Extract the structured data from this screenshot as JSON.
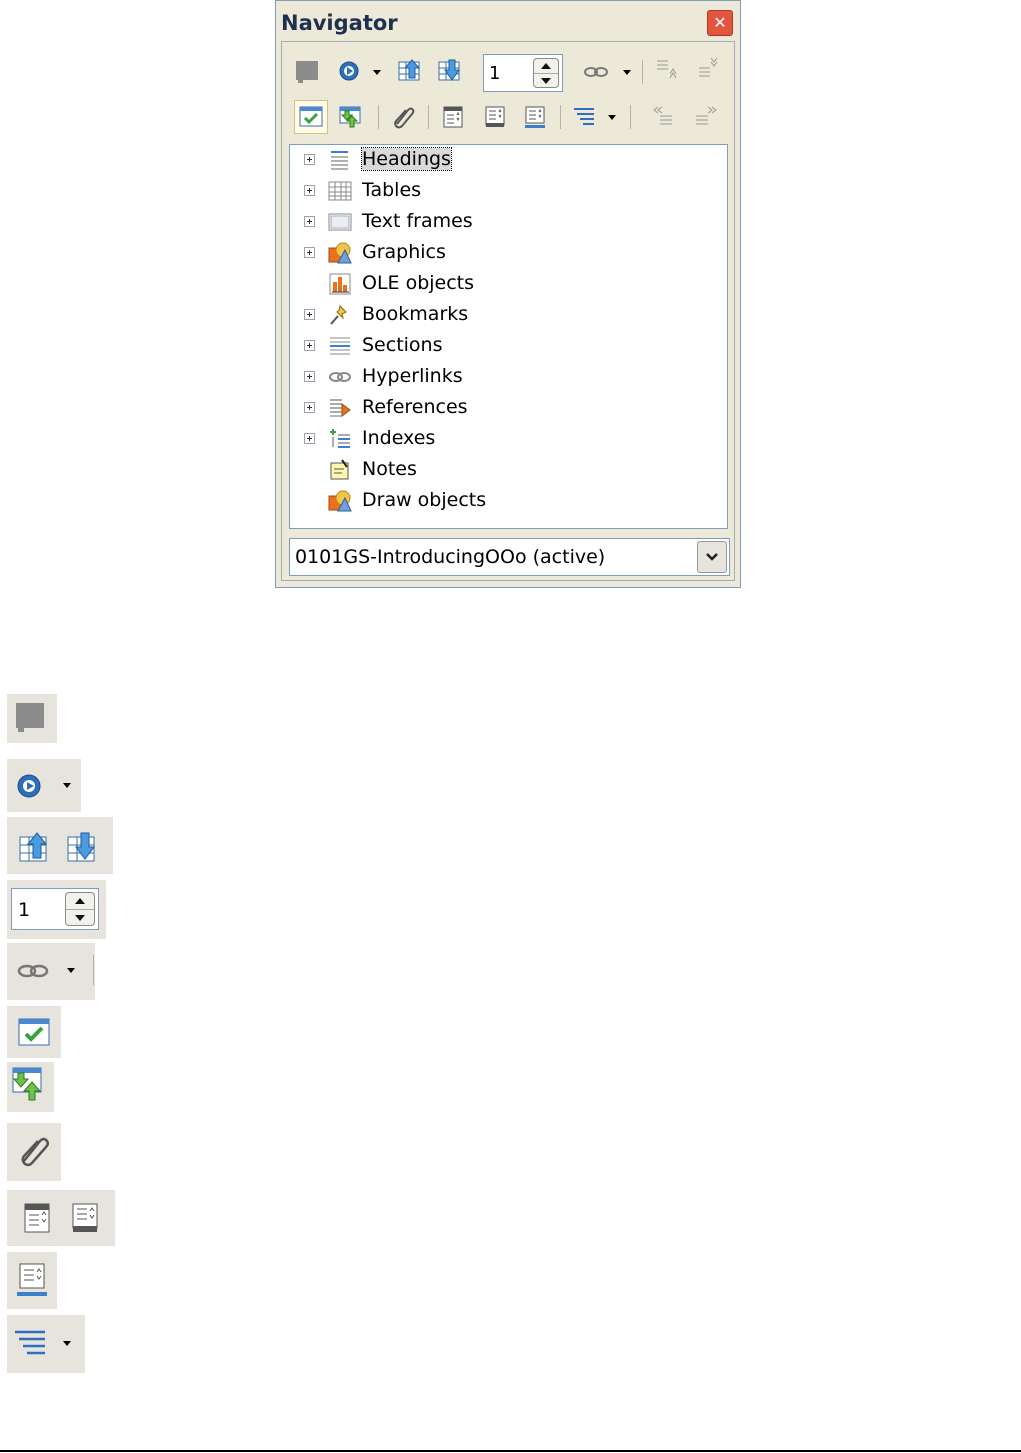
{
  "window": {
    "title": "Navigator",
    "close_icon": "close-icon"
  },
  "toolbar": {
    "row1": [
      "toggle-icon",
      "navigation-icon",
      "previous-icon",
      "next-icon",
      "page-spin",
      "drag-mode-icon",
      "promote-level-icon",
      "demote-level-icon"
    ],
    "page_number": "1",
    "row2": [
      "list-box-on-off-icon",
      "content-view-icon",
      "set-reminder-icon",
      "header-icon",
      "footer-icon",
      "anchor-to-text-icon",
      "heading-levels-icon",
      "promote-chapter-icon",
      "demote-chapter-icon"
    ]
  },
  "tree": {
    "items": [
      {
        "label": "Headings",
        "icon": "headings-icon",
        "expandable": true,
        "selected": true
      },
      {
        "label": "Tables",
        "icon": "tables-icon",
        "expandable": true
      },
      {
        "label": "Text frames",
        "icon": "text-frames-icon",
        "expandable": true
      },
      {
        "label": "Graphics",
        "icon": "graphics-icon",
        "expandable": true
      },
      {
        "label": "OLE objects",
        "icon": "ole-objects-icon",
        "expandable": false
      },
      {
        "label": "Bookmarks",
        "icon": "bookmarks-icon",
        "expandable": true
      },
      {
        "label": "Sections",
        "icon": "sections-icon",
        "expandable": true
      },
      {
        "label": "Hyperlinks",
        "icon": "hyperlinks-icon",
        "expandable": true
      },
      {
        "label": "References",
        "icon": "references-icon",
        "expandable": true
      },
      {
        "label": "Indexes",
        "icon": "indexes-icon",
        "expandable": true
      },
      {
        "label": "Notes",
        "icon": "notes-icon",
        "expandable": false
      },
      {
        "label": "Draw objects",
        "icon": "draw-objects-icon",
        "expandable": false
      }
    ]
  },
  "document_select": {
    "value": "0101GS-IntroducingOOo (active)"
  },
  "legend": {
    "page_number": "1",
    "icons": [
      "toggle-icon",
      "navigation-icon",
      "previous-next-icon",
      "page-spin",
      "drag-mode-icon",
      "list-box-on-off-icon",
      "content-view-icon",
      "set-reminder-icon",
      "header-footer-icon",
      "anchor-to-text-icon",
      "heading-levels-icon"
    ]
  },
  "colors": {
    "window_bg": "#ece9d8",
    "accent_blue": "#2f6fc0",
    "close_red": "#e45540",
    "legend_bg": "#e6e4dc"
  }
}
